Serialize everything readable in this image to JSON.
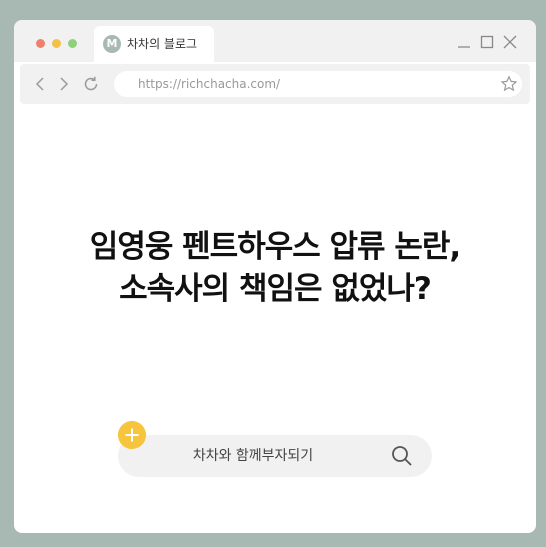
{
  "window": {
    "traffic_lights": [
      "#f0806e",
      "#f3c14b",
      "#8fd07a"
    ]
  },
  "tab": {
    "favicon_letter": "M",
    "title": "차차의 블로그",
    "favicon_color": "#a8b8b3"
  },
  "window_controls": {
    "icons": [
      "minimize-icon",
      "maximize-icon",
      "close-icon"
    ]
  },
  "navbar": {
    "url": "https://richchacha.com/"
  },
  "headline": {
    "line1": "임영웅 펜트하우스 압류 논란,",
    "line2": "소속사의 책임은 없었나?"
  },
  "search": {
    "label": "차차와 함께부자되기",
    "accent": "#f7c43d"
  }
}
